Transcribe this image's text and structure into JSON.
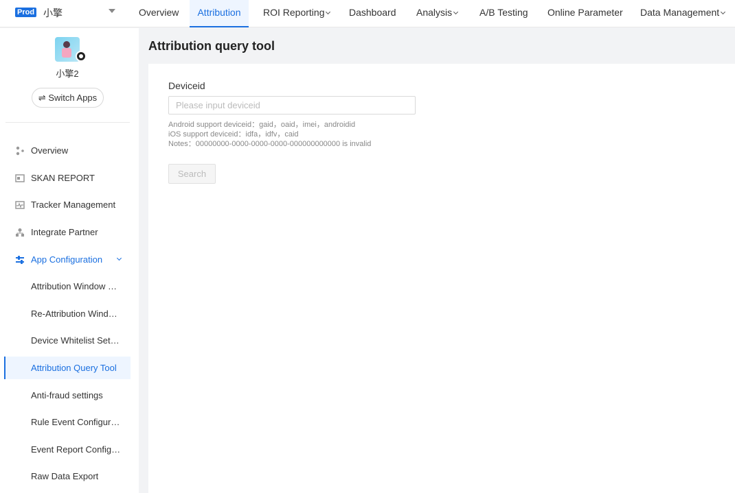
{
  "header": {
    "env_badge": "Prod",
    "app_name": "小擎",
    "nav": [
      {
        "label": "Overview"
      },
      {
        "label": "Attribution"
      },
      {
        "label": "ROI Reporting"
      },
      {
        "label": "Dashboard"
      },
      {
        "label": "Analysis"
      },
      {
        "label": "A/B Testing"
      },
      {
        "label": "Online Parameter"
      },
      {
        "label": "Data Management"
      }
    ],
    "active_nav": "Attribution"
  },
  "sidebar": {
    "app_label": "小擎2",
    "switch_label": "Switch Apps",
    "switch_icon": "⇌",
    "menu": [
      {
        "label": "Overview",
        "icon": "overview-icon"
      },
      {
        "label": "SKAN REPORT",
        "icon": "skan-report-icon"
      },
      {
        "label": "Tracker Management",
        "icon": "tracker-icon"
      },
      {
        "label": "Integrate Partner",
        "icon": "partner-icon"
      },
      {
        "label": "App Configuration",
        "icon": "settings-sliders-icon"
      }
    ],
    "submenu": [
      {
        "label": "Attribution Window Configuration"
      },
      {
        "label": "Re-Attribution Window Configuration"
      },
      {
        "label": "Device Whitelist Settings"
      },
      {
        "label": "Attribution Query Tool"
      },
      {
        "label": "Anti-fraud settings"
      },
      {
        "label": "Rule Event Configuration"
      },
      {
        "label": "Event Report Configuration"
      },
      {
        "label": "Raw Data Export"
      }
    ],
    "active_submenu": "Attribution Query Tool"
  },
  "main": {
    "title": "Attribution query tool",
    "field_label": "Deviceid",
    "input_value": "",
    "input_placeholder": "Please input deviceid",
    "hints": [
      "Android support deviceid：gaid，oaid，imei，androidid",
      "iOS support deviceid：idfa，idfv，caid",
      "Notes：00000000-0000-0000-0000-000000000000 is invalid"
    ],
    "search_label": "Search"
  },
  "colors": {
    "accent": "#1a6fe0",
    "page_bg": "#f2f3f5"
  }
}
